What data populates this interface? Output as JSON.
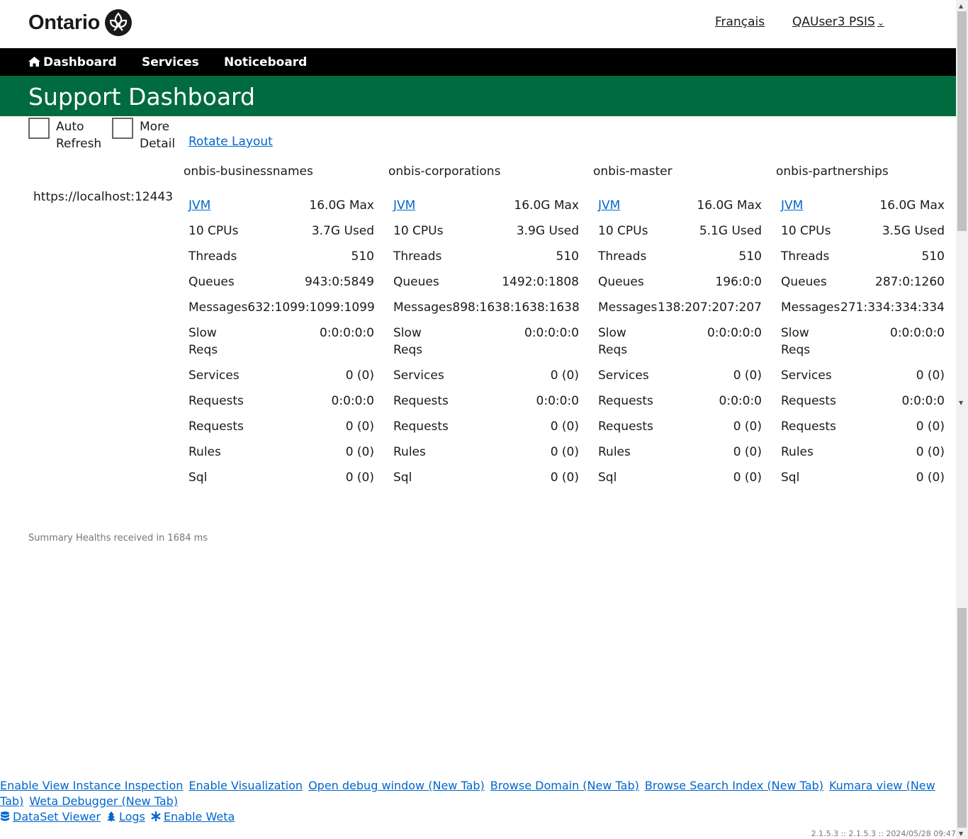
{
  "header": {
    "logo_text": "Ontario",
    "language_link": "Français",
    "user_menu": "QAUser3 PSIS"
  },
  "nav": {
    "dashboard": "Dashboard",
    "services": "Services",
    "noticeboard": "Noticeboard"
  },
  "page": {
    "title": "Support Dashboard"
  },
  "controls": {
    "auto_refresh_line1": "Auto",
    "auto_refresh_line2": "Refresh",
    "more_detail_line1": "More",
    "more_detail_line2": "Detail",
    "rotate_layout": "Rotate Layout"
  },
  "host": "https://localhost:12443",
  "columns": [
    {
      "name": "onbis-businessnames",
      "jvm": "JVM",
      "jvm_max": "16.0G Max",
      "cpus": "10 CPUs",
      "used": "3.7G Used",
      "threads_label": "Threads",
      "threads": "510",
      "queues_label": "Queues",
      "queues": "943:0:5849",
      "messages_label": "Messages",
      "messages": "632:1099:1099:1099",
      "slow_label_1": "Slow",
      "slow_label_2": "Reqs",
      "slow": "0:0:0:0:0",
      "services_label": "Services",
      "services": "0 (0)",
      "requests_label": "Requests",
      "requests": "0:0:0:0",
      "requests2_label": "Requests",
      "requests2": "0 (0)",
      "rules_label": "Rules",
      "rules": "0 (0)",
      "sql_label": "Sql",
      "sql": "0 (0)"
    },
    {
      "name": "onbis-corporations",
      "jvm": "JVM",
      "jvm_max": "16.0G Max",
      "cpus": "10 CPUs",
      "used": "3.9G Used",
      "threads_label": "Threads",
      "threads": "510",
      "queues_label": "Queues",
      "queues": "1492:0:1808",
      "messages_label": "Messages",
      "messages": "898:1638:1638:1638",
      "slow_label_1": "Slow",
      "slow_label_2": "Reqs",
      "slow": "0:0:0:0:0",
      "services_label": "Services",
      "services": "0 (0)",
      "requests_label": "Requests",
      "requests": "0:0:0:0",
      "requests2_label": "Requests",
      "requests2": "0 (0)",
      "rules_label": "Rules",
      "rules": "0 (0)",
      "sql_label": "Sql",
      "sql": "0 (0)"
    },
    {
      "name": "onbis-master",
      "jvm": "JVM",
      "jvm_max": "16.0G Max",
      "cpus": "10 CPUs",
      "used": "5.1G Used",
      "threads_label": "Threads",
      "threads": "510",
      "queues_label": "Queues",
      "queues": "196:0:0",
      "messages_label": "Messages",
      "messages": "138:207:207:207",
      "slow_label_1": "Slow",
      "slow_label_2": "Reqs",
      "slow": "0:0:0:0:0",
      "services_label": "Services",
      "services": "0 (0)",
      "requests_label": "Requests",
      "requests": "0:0:0:0",
      "requests2_label": "Requests",
      "requests2": "0 (0)",
      "rules_label": "Rules",
      "rules": "0 (0)",
      "sql_label": "Sql",
      "sql": "0 (0)"
    },
    {
      "name": "onbis-partnerships",
      "jvm": "JVM",
      "jvm_max": "16.0G Max",
      "cpus": "10 CPUs",
      "used": "3.5G Used",
      "threads_label": "Threads",
      "threads": "510",
      "queues_label": "Queues",
      "queues": "287:0:1260",
      "messages_label": "Messages",
      "messages": "271:334:334:334",
      "slow_label_1": "Slow",
      "slow_label_2": "Reqs",
      "slow": "0:0:0:0:0",
      "services_label": "Services",
      "services": "0 (0)",
      "requests_label": "Requests",
      "requests": "0:0:0:0",
      "requests2_label": "Requests",
      "requests2": "0 (0)",
      "rules_label": "Rules",
      "rules": "0 (0)",
      "sql_label": "Sql",
      "sql": "0 (0)"
    }
  ],
  "summary": "Summary Healths received in 1684 ms",
  "footer": {
    "enable_view_instance_inspection": "Enable View Instance Inspection",
    "enable_visualization": "Enable Visualization",
    "open_debug_window": "Open debug window (New Tab)",
    "browse_domain": "Browse Domain (New Tab)",
    "browse_search_index": "Browse Search Index (New Tab)",
    "kumara_view": "Kumara view (New Tab)",
    "weta_debugger": "Weta Debugger (New Tab)",
    "dataset_viewer": "DataSet Viewer",
    "logs": "Logs",
    "enable_weta": "Enable Weta",
    "version": "2.1.5.3 :: 2.1.5.3 :: 2024/05/28 09:47"
  }
}
